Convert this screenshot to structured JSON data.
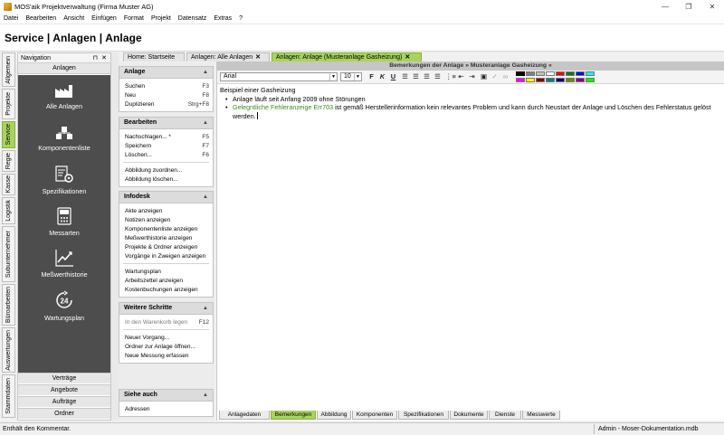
{
  "window": {
    "title": "MOS'aik Projektverwaltung (Firma Muster AG)",
    "controls": [
      "—",
      "❐",
      "✕"
    ]
  },
  "menu": [
    "Datei",
    "Bearbeiten",
    "Ansicht",
    "Einfügen",
    "Format",
    "Projekt",
    "Datensatz",
    "Extras",
    "?"
  ],
  "page_title": "Service | Anlagen | Anlage",
  "left_tabs": [
    "Allgemein",
    "Projekte",
    "Service",
    "Regie",
    "Kasse",
    "Logistik",
    "Subunternehmer",
    "Büroarbeiten",
    "Auswertungen",
    "Stammdaten"
  ],
  "active_left_tab": "Service",
  "navigation": {
    "title": "Navigation",
    "pin": "⊓",
    "close": "✕",
    "section": "Anlagen",
    "items": [
      "Alle Anlagen",
      "Komponentenliste",
      "Spezifikationen",
      "Messarten",
      "Meßwerthistorie",
      "Wartungsplan"
    ],
    "bottom": [
      "Verträge",
      "Angebote",
      "Aufträge",
      "Ordner"
    ]
  },
  "doc_tabs": [
    {
      "label": "Home: Startseite",
      "close": ""
    },
    {
      "label": "Anlagen: Alle Anlagen",
      "close": "✕"
    },
    {
      "label": "Anlagen: Anlage (Musteranlage Gasheizung)",
      "close": "✕"
    }
  ],
  "task_panels": {
    "anlage": {
      "title": "Anlage",
      "items": [
        {
          "label": "Suchen",
          "key": "F3"
        },
        {
          "label": "Neu",
          "key": "F8"
        },
        {
          "label": "Duplizieren",
          "key": "Strg+F8"
        }
      ]
    },
    "bearbeiten": {
      "title": "Bearbeiten",
      "items": [
        {
          "label": "Nachschlagen... *",
          "key": "F5"
        },
        {
          "label": "Speichern",
          "key": "F7"
        },
        {
          "label": "Löschen...",
          "key": "F6"
        },
        {
          "label": "Abbildung zuordnen...",
          "key": ""
        },
        {
          "label": "Abbildung löschen...",
          "key": ""
        }
      ]
    },
    "infodesk": {
      "title": "Infodesk",
      "items": [
        "Akte anzeigen",
        "Notizen anzeigen",
        "Komponentenliste anzeigen",
        "Meßwerthistorie anzeigen",
        "Projekte & Ordner anzeigen",
        "Vorgänge in Zweigen anzeigen",
        "Wartungsplan",
        "Arbeitszettel anzeigen",
        "Kostenbuchungen anzeigen"
      ]
    },
    "weitere": {
      "title": "Weitere Schritte",
      "items": [
        {
          "label": "In den Warenkorb legen",
          "key": "F12"
        },
        {
          "label": "Neuer Vorgang...",
          "key": ""
        },
        {
          "label": "Ordner zur Anlage öffnen...",
          "key": ""
        },
        {
          "label": "Neue Messung erfassen",
          "key": ""
        }
      ]
    },
    "siehe": {
      "title": "Siehe auch",
      "items": [
        "Adressen"
      ]
    }
  },
  "editor": {
    "header": "Bemerkungen der Anlage » Musteranlage Gasheizung «",
    "font": "Arial",
    "size": "10",
    "colors": [
      "#000000",
      "#808080",
      "#c0c0c0",
      "#ffffff",
      "#ff0000",
      "#008000",
      "#0000ff",
      "#00ffff",
      "#ff00ff",
      "#ffff00",
      "#800000",
      "#008080",
      "#000080",
      "#808000",
      "#800080",
      "#00ff00"
    ],
    "content": {
      "heading": "Beispiel einer Gasheizung",
      "bullet1": "Anlage läuft seit Anfang 2009 ohne Störungen",
      "bullet2_green": "Gelegntliche Fehleranzeige Err703",
      "bullet2_rest": " ist gemäß Herstellerinformation kein relevantes Problem und kann durch Neustart der Anlage und Löschen des Fehlerstatus gelöst werden."
    }
  },
  "bottom_tabs": [
    "Anlagedaten",
    "Bemerkungen",
    "Abbildung",
    "Komponenten",
    "Spezifikationen",
    "Dokumente",
    "Dienste",
    "Messwerte"
  ],
  "active_bottom_tab": "Bemerkungen",
  "status": {
    "left": "Enthält den Kommentar.",
    "right": "Admin - Moser-Dokumentation.mdb"
  }
}
